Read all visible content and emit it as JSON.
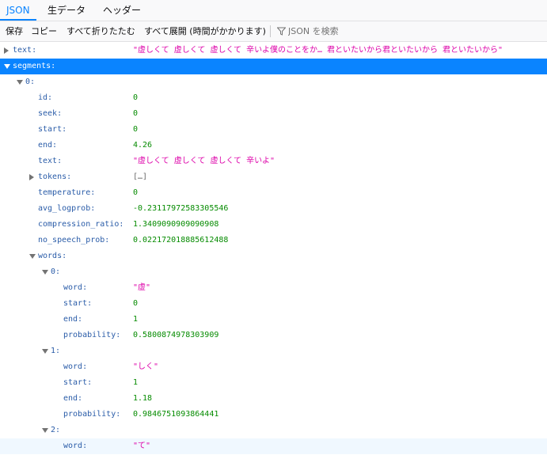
{
  "tabs": [
    {
      "label": "JSON",
      "active": true
    },
    {
      "label": "生データ",
      "active": false
    },
    {
      "label": "ヘッダー",
      "active": false
    }
  ],
  "toolbar": {
    "save": "保存",
    "copy": "コピー",
    "collapse_all": "すべて折りたたむ",
    "expand_all": "すべて展開 (時間がかかります)",
    "filter_placeholder": "JSON を検索",
    "filter_icon": "filter-icon"
  },
  "colors": {
    "accent": "#0a84ff",
    "key": "#2a5ca8",
    "string": "#dd00a9",
    "number": "#058b00"
  },
  "rows": [
    {
      "key": "text:",
      "value": "\"虚しくて 虚しくて 虚しくて 辛いよ僕のことをか… 君といたいから君といたいから 君といたいから\"",
      "type": "str",
      "twisty": "closed",
      "depth": 0
    },
    {
      "key": "segments:",
      "value": "",
      "type": "none",
      "twisty": "open",
      "depth": 0,
      "selected": true
    },
    {
      "key": "0:",
      "value": "",
      "type": "none",
      "twisty": "open",
      "depth": 1
    },
    {
      "key": "id:",
      "value": "0",
      "type": "num",
      "twisty": "",
      "depth": 2
    },
    {
      "key": "seek:",
      "value": "0",
      "type": "num",
      "twisty": "",
      "depth": 2
    },
    {
      "key": "start:",
      "value": "0",
      "type": "num",
      "twisty": "",
      "depth": 2
    },
    {
      "key": "end:",
      "value": "4.26",
      "type": "num",
      "twisty": "",
      "depth": 2
    },
    {
      "key": "text:",
      "value": "\"虚しくて 虚しくて 虚しくて 辛いよ\"",
      "type": "str",
      "twisty": "",
      "depth": 2
    },
    {
      "key": "tokens:",
      "value": "[…]",
      "type": "other",
      "twisty": "closed",
      "depth": 2
    },
    {
      "key": "temperature:",
      "value": "0",
      "type": "num",
      "twisty": "",
      "depth": 2
    },
    {
      "key": "avg_logprob:",
      "value": "-0.23117972583305546",
      "type": "num",
      "twisty": "",
      "depth": 2
    },
    {
      "key": "compression_ratio:",
      "value": "1.3409090909090908",
      "type": "num",
      "twisty": "",
      "depth": 2
    },
    {
      "key": "no_speech_prob:",
      "value": "0.022172018885612488",
      "type": "num",
      "twisty": "",
      "depth": 2
    },
    {
      "key": "words:",
      "value": "",
      "type": "none",
      "twisty": "open",
      "depth": 2
    },
    {
      "key": "0:",
      "value": "",
      "type": "none",
      "twisty": "open",
      "depth": 3
    },
    {
      "key": "word:",
      "value": "\"虚\"",
      "type": "str",
      "twisty": "",
      "depth": 4
    },
    {
      "key": "start:",
      "value": "0",
      "type": "num",
      "twisty": "",
      "depth": 4
    },
    {
      "key": "end:",
      "value": "1",
      "type": "num",
      "twisty": "",
      "depth": 4
    },
    {
      "key": "probability:",
      "value": "0.5800874978303909",
      "type": "num",
      "twisty": "",
      "depth": 4
    },
    {
      "key": "1:",
      "value": "",
      "type": "none",
      "twisty": "open",
      "depth": 3
    },
    {
      "key": "word:",
      "value": "\"しく\"",
      "type": "str",
      "twisty": "",
      "depth": 4
    },
    {
      "key": "start:",
      "value": "1",
      "type": "num",
      "twisty": "",
      "depth": 4
    },
    {
      "key": "end:",
      "value": "1.18",
      "type": "num",
      "twisty": "",
      "depth": 4
    },
    {
      "key": "probability:",
      "value": "0.9846751093864441",
      "type": "num",
      "twisty": "",
      "depth": 4
    },
    {
      "key": "2:",
      "value": "",
      "type": "none",
      "twisty": "open",
      "depth": 3
    },
    {
      "key": "word:",
      "value": "\"て\"",
      "type": "str",
      "twisty": "",
      "depth": 4,
      "hover": true
    }
  ]
}
